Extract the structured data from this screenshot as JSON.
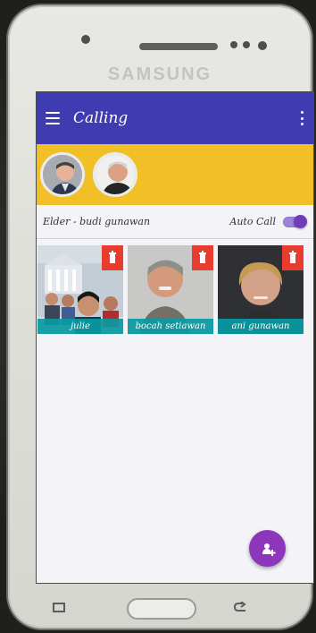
{
  "device": {
    "brand": "SAMSUNG"
  },
  "app": {
    "title": "Calling",
    "menu_icon": "hamburger-menu-icon",
    "overflow_icon": "more-vert-icon"
  },
  "favorites": {
    "items": [
      {
        "name": "",
        "avatar": "man-portrait"
      },
      {
        "name": "",
        "avatar": "bald-man-portrait"
      }
    ]
  },
  "status_bar": {
    "elder_text": "Elder - budi gunawan",
    "auto_call_label": "Auto Call",
    "auto_call_enabled": true
  },
  "contacts": [
    {
      "name": "julie",
      "photo": "group-photo",
      "delete_icon": "trash-icon"
    },
    {
      "name": "bocah setiawan",
      "photo": "smiling-man-photo",
      "delete_icon": "trash-icon"
    },
    {
      "name": "ani gunawan",
      "photo": "woman-photo",
      "delete_icon": "trash-icon"
    }
  ],
  "fab": {
    "icon": "add-contact-icon"
  },
  "colors": {
    "app_bar": "#3f3bb1",
    "strip": "#f1bf26",
    "card_label": "#099aa2",
    "delete": "#e63d30",
    "fab": "#8d35bb",
    "toggle": "#6f3eb5"
  }
}
